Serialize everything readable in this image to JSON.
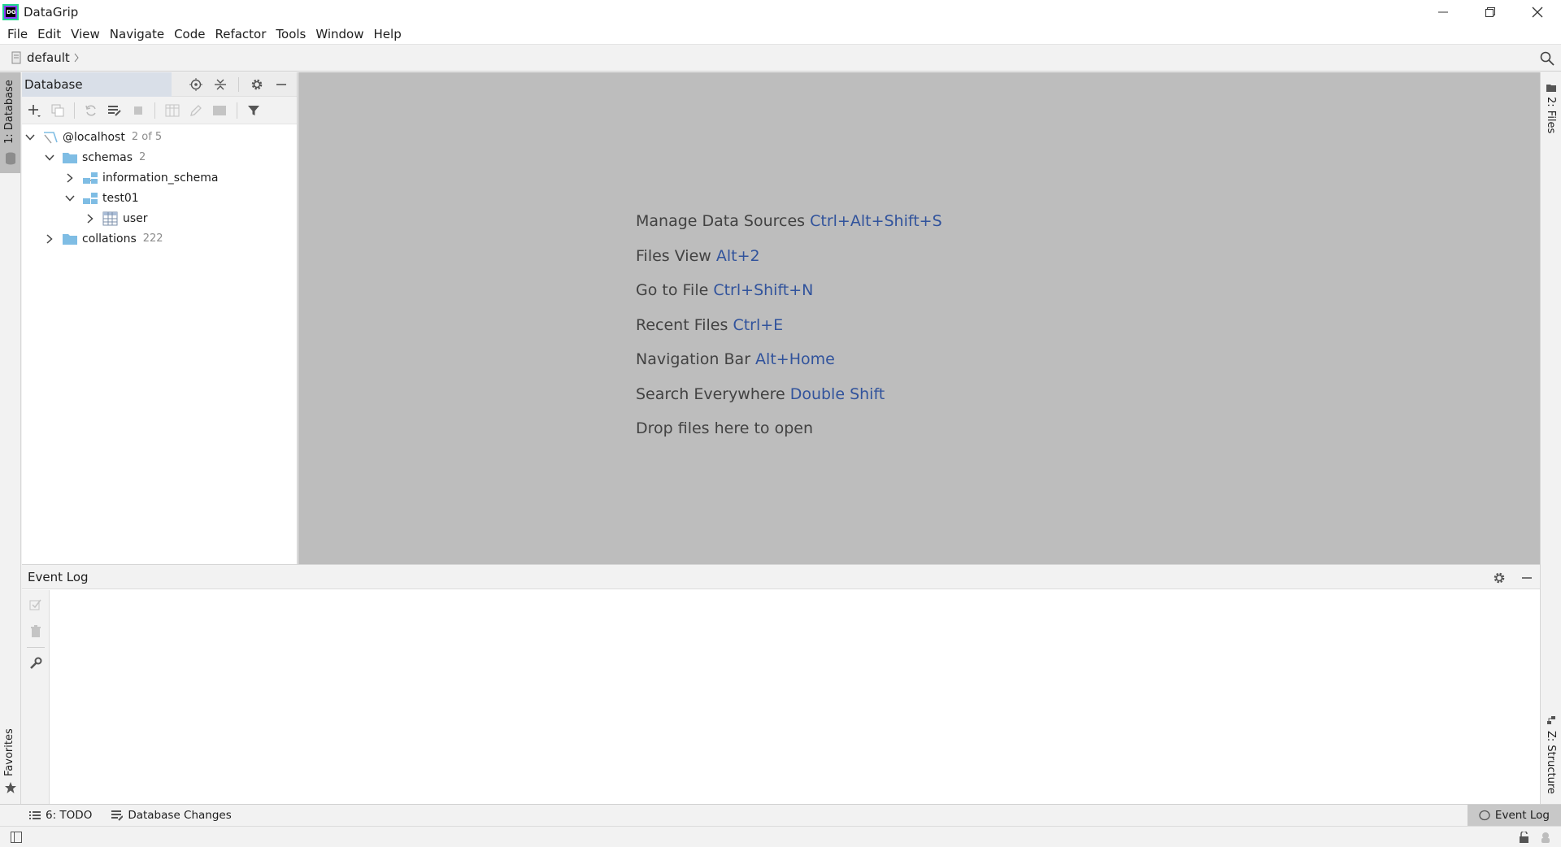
{
  "window": {
    "title": "DataGrip",
    "logo_text": "DG"
  },
  "menu": [
    "File",
    "Edit",
    "View",
    "Navigate",
    "Code",
    "Refactor",
    "Tools",
    "Window",
    "Help"
  ],
  "navbar": {
    "crumb": "default"
  },
  "left_stripe": {
    "database_tab": "1: Database",
    "favorites_tab": "Favorites"
  },
  "right_stripe": {
    "files_tab": "2: Files",
    "structure_tab": "Z: Structure"
  },
  "database_panel": {
    "title": "Database",
    "tree": [
      {
        "label": "@localhost",
        "count": "2 of 5",
        "level": 0,
        "expanded": true,
        "icon": "datasource-icon"
      },
      {
        "label": "schemas",
        "count": "2",
        "level": 1,
        "expanded": true,
        "icon": "folder-icon"
      },
      {
        "label": "information_schema",
        "count": "",
        "level": 2,
        "expanded": false,
        "icon": "schema-icon"
      },
      {
        "label": "test01",
        "count": "",
        "level": 2,
        "expanded": true,
        "icon": "schema-icon"
      },
      {
        "label": "user",
        "count": "",
        "level": 3,
        "expanded": false,
        "icon": "table-icon"
      },
      {
        "label": "collations",
        "count": "222",
        "level": 1,
        "expanded": false,
        "icon": "folder-icon"
      }
    ]
  },
  "editor_hints": [
    {
      "text": "Manage Data Sources ",
      "key": "Ctrl+Alt+Shift+S"
    },
    {
      "text": "Files View ",
      "key": "Alt+2"
    },
    {
      "text": "Go to File ",
      "key": "Ctrl+Shift+N"
    },
    {
      "text": "Recent Files ",
      "key": "Ctrl+E"
    },
    {
      "text": "Navigation Bar ",
      "key": "Alt+Home"
    },
    {
      "text": "Search Everywhere ",
      "key": "Double Shift"
    },
    {
      "text": "Drop files here to open",
      "key": ""
    }
  ],
  "event_log": {
    "title": "Event Log"
  },
  "bottom_bar": {
    "todo_label": "6: TODO",
    "db_changes_label": "Database Changes",
    "event_log_label": "Event Log"
  },
  "colors": {
    "accent_key": "#31539c",
    "editor_bg": "#bdbdbd",
    "folder": "#7fbde4"
  }
}
